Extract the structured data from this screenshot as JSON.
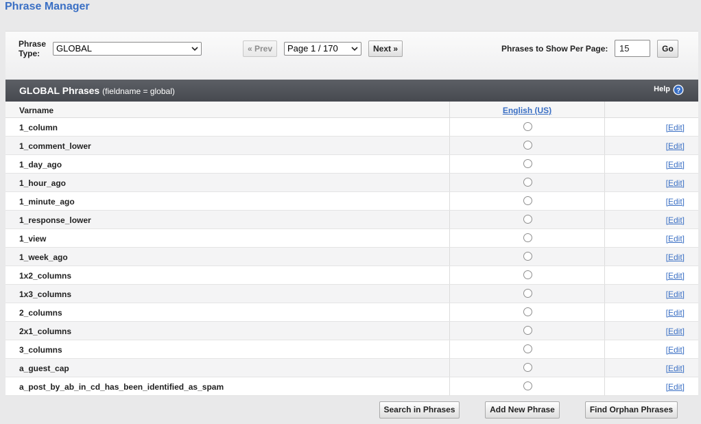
{
  "page": {
    "title": "Phrase Manager"
  },
  "filter": {
    "phrase_type_label": "Phrase Type:",
    "phrase_type_value": "GLOBAL",
    "prev_label": "« Prev",
    "page_select_value": "Page 1 / 170",
    "next_label": "Next »",
    "per_page_label": "Phrases to Show Per Page:",
    "per_page_value": "15",
    "go_label": "Go"
  },
  "table": {
    "title": "GLOBAL Phrases",
    "subtitle": "(fieldname = global)",
    "help_label": "Help",
    "col_varname": "Varname",
    "col_language": "English (US)",
    "edit_label": "[Edit]",
    "rows": [
      "1_column",
      "1_comment_lower",
      "1_day_ago",
      "1_hour_ago",
      "1_minute_ago",
      "1_response_lower",
      "1_view",
      "1_week_ago",
      "1x2_columns",
      "1x3_columns",
      "2_columns",
      "2x1_columns",
      "3_columns",
      "a_guest_cap",
      "a_post_by_ab_in_cd_has_been_identified_as_spam"
    ]
  },
  "footer": {
    "search_label": "Search in Phrases",
    "add_label": "Add New Phrase",
    "orphan_label": "Find Orphan Phrases"
  },
  "colors": {
    "accent": "#3a6fc4",
    "header_bg": "#4b4e54",
    "page_bg": "#e9e9ea"
  }
}
